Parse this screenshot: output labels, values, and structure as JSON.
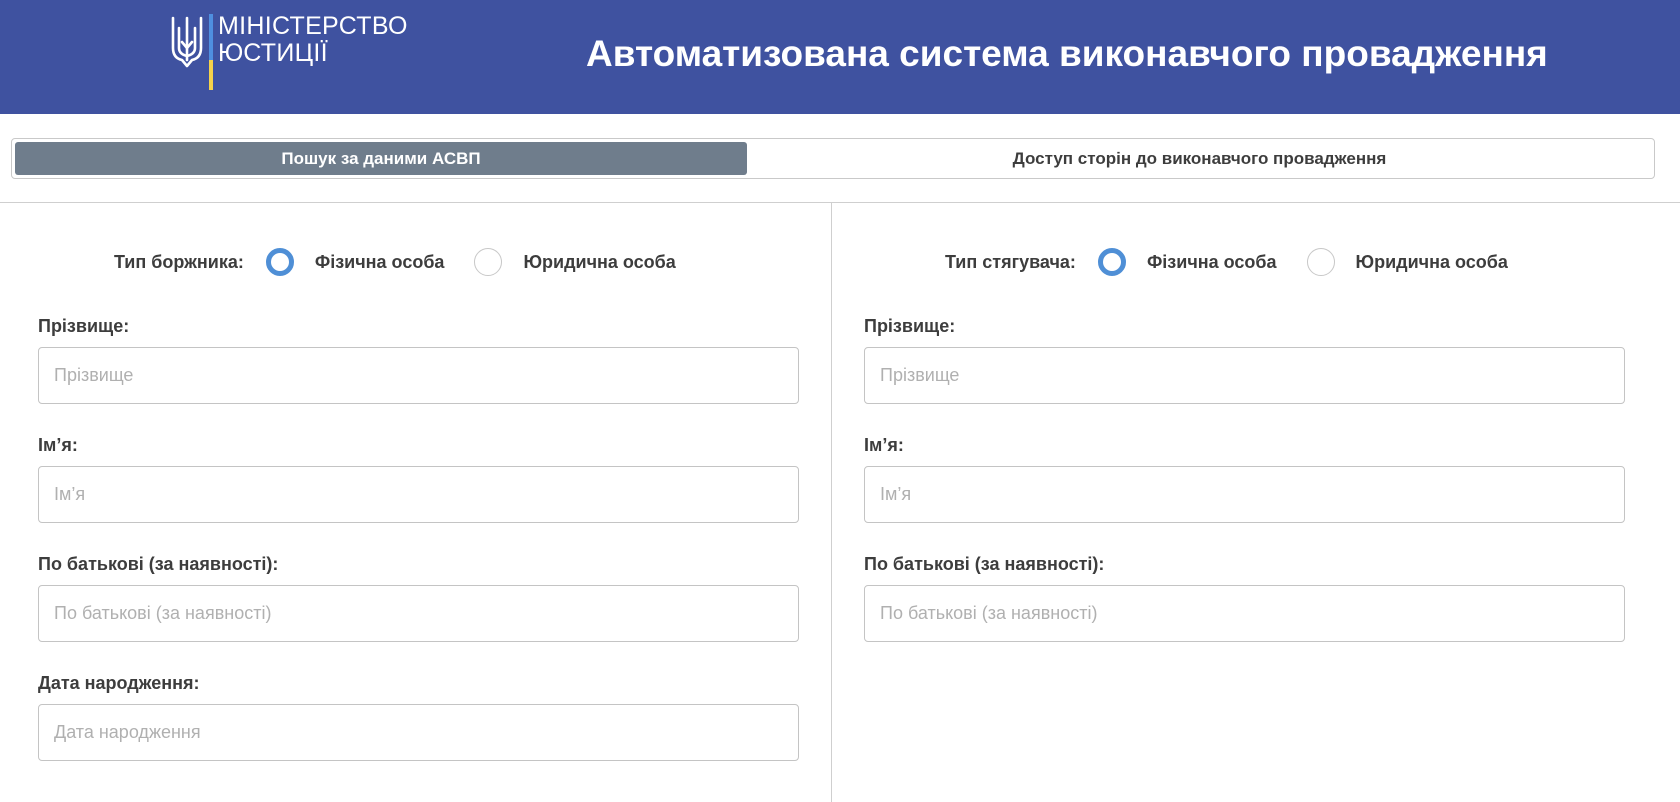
{
  "header": {
    "logo_line1": "МІНІСТЕРСТВО",
    "logo_line2": "ЮСТИЦІЇ",
    "title": "Автоматизована система виконавчого провадження",
    "colors": {
      "background": "#3f52a0",
      "flag_blue": "#4f8fe0",
      "flag_yellow": "#f5d24b"
    }
  },
  "tabs": [
    {
      "label": "Пошук за даними АСВП",
      "active": true
    },
    {
      "label": "Доступ сторін до виконавчого провадження",
      "active": false
    }
  ],
  "debtor": {
    "type_label": "Тип боржника:",
    "options": [
      {
        "label": "Фізична особа",
        "checked": true
      },
      {
        "label": "Юридична особа",
        "checked": false
      }
    ],
    "fields": [
      {
        "label": "Прізвище:",
        "placeholder": "Прізвище",
        "value": ""
      },
      {
        "label": "Ім’я:",
        "placeholder": "Ім’я",
        "value": ""
      },
      {
        "label": "По батькові (за наявності):",
        "placeholder": "По батькові (за наявності)",
        "value": ""
      },
      {
        "label": "Дата народження:",
        "placeholder": "Дата народження",
        "value": ""
      }
    ]
  },
  "collector": {
    "type_label": "Тип стягувача:",
    "options": [
      {
        "label": "Фізична особа",
        "checked": true
      },
      {
        "label": "Юридична особа",
        "checked": false
      }
    ],
    "fields": [
      {
        "label": "Прізвище:",
        "placeholder": "Прізвище",
        "value": ""
      },
      {
        "label": "Ім’я:",
        "placeholder": "Ім’я",
        "value": ""
      },
      {
        "label": "По батькові (за наявності):",
        "placeholder": "По батькові (за наявності)",
        "value": ""
      }
    ]
  },
  "colors": {
    "active_tab": "#6f7d8c",
    "radio_checked": "#4f8fd6"
  },
  "icons": {
    "logo": "trident-coat-of-arms-icon"
  }
}
